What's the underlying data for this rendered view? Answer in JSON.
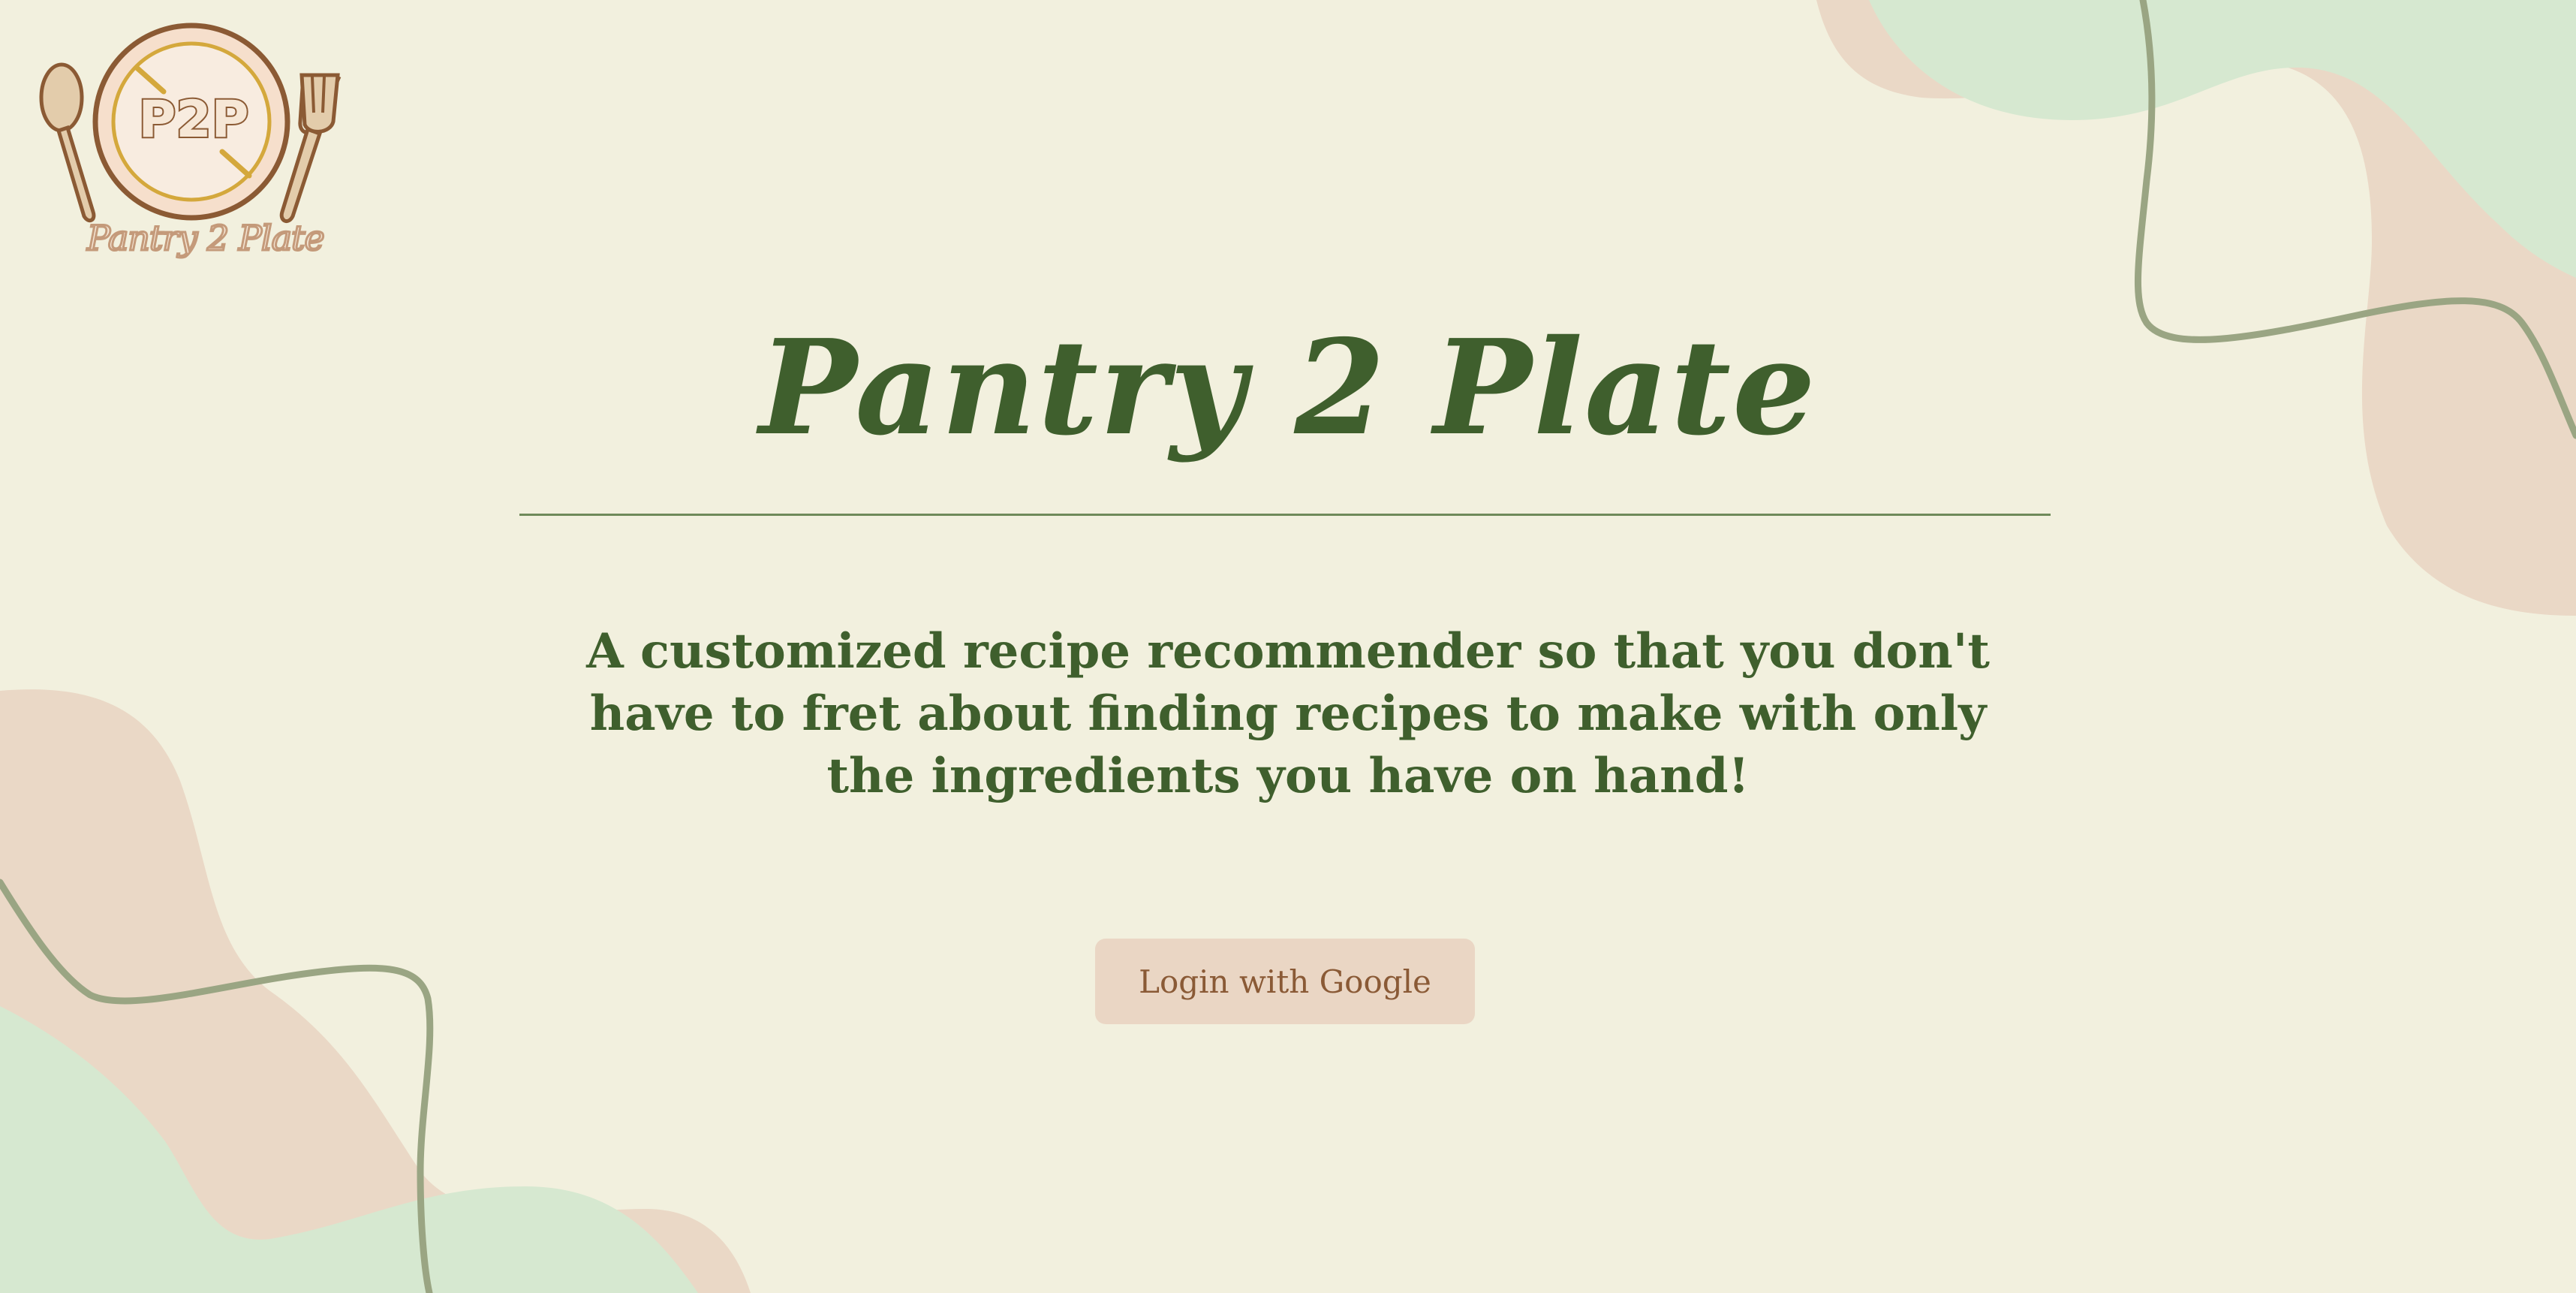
{
  "logo": {
    "monogram": "P2P",
    "caption": "Pantry 2 Plate"
  },
  "hero": {
    "title": "Pantry 2 Plate",
    "tagline": "A customized recipe recommender so that you don't have to fret about finding recipes to make with only the ingredients you have on hand!"
  },
  "actions": {
    "login_label": "Login with Google"
  },
  "colors": {
    "background": "#f2f0de",
    "primary_text": "#3f5f2d",
    "button_bg": "#ead6c4",
    "button_text": "#8a5a36",
    "blob_peach": "#ead8c6",
    "blob_green": "#d6e8d0",
    "squiggle": "#9aa583"
  }
}
